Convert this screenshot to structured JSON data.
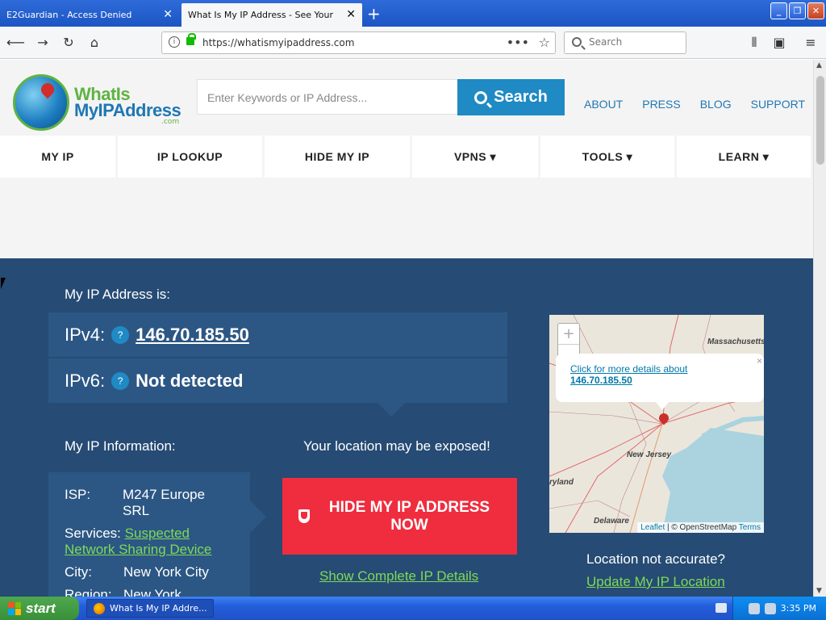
{
  "browser": {
    "tabs": [
      {
        "title": "E2Guardian - Access Denied",
        "active": false
      },
      {
        "title": "What Is My IP Address - See Your Publ",
        "active": true
      }
    ],
    "url": "https://whatismyipaddress.com",
    "search_placeholder": "Search"
  },
  "site": {
    "logo_line1": "WhatIs",
    "logo_line2": "MyIPAddress",
    "logo_com": ".com",
    "search_placeholder": "Enter Keywords or IP Address...",
    "search_button": "Search",
    "top_links": [
      "ABOUT",
      "PRESS",
      "BLOG",
      "SUPPORT"
    ],
    "nav": [
      "MY IP",
      "IP LOOKUP",
      "HIDE MY IP",
      "VPNS ▾",
      "TOOLS ▾",
      "LEARN ▾"
    ]
  },
  "hero": {
    "my_ip_label": "My IP Address is:",
    "ipv4_label": "IPv4:",
    "ipv4_value": "146.70.185.50",
    "ipv6_label": "IPv6:",
    "ipv6_value": "Not detected",
    "help_mark": "?",
    "info_label": "My IP Information:",
    "exposed_text": "Your location may be exposed!",
    "isp_key": "ISP:",
    "isp_value": "M247 Europe SRL",
    "services_key": "Services:",
    "services_value": "Suspected Network Sharing Device",
    "city_key": "City:",
    "city_value": "New York City",
    "region_key": "Region:",
    "region_value": "New York",
    "hide_button": "HIDE MY IP ADDRESS NOW",
    "complete_link": "Show Complete IP Details",
    "location_question": "Location not accurate?",
    "update_link": "Update My IP Location"
  },
  "map": {
    "zoom_in": "+",
    "zoom_out": "−",
    "popup_text": "Click for more details about",
    "popup_ip": "146.70.185.50",
    "labels": [
      "Massachusetts",
      "New Jersey",
      "ryland",
      "Delaware"
    ],
    "attribution_leaflet": "Leaflet",
    "attribution_osm": "| © OpenStreetMap",
    "attribution_terms": "Terms"
  },
  "taskbar": {
    "start": "start",
    "item": "What Is My IP Addre...",
    "clock": "3:35 PM"
  }
}
